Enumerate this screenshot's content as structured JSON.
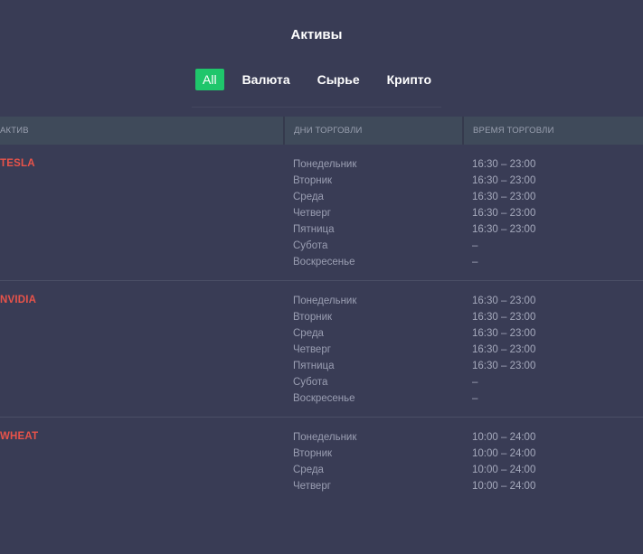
{
  "page": {
    "title": "Активы"
  },
  "tabs": [
    {
      "label": "All",
      "active": true
    },
    {
      "label": "Валюта",
      "active": false
    },
    {
      "label": "Сырье",
      "active": false
    },
    {
      "label": "Крипто",
      "active": false
    }
  ],
  "table": {
    "headers": {
      "asset": "АКТИВ",
      "days": "ДНИ ТОРГОВЛИ",
      "time": "ВРЕМЯ ТОРГОВЛИ"
    },
    "rows": [
      {
        "asset": "TESLA",
        "days": [
          "Понедельник",
          "Вторник",
          "Среда",
          "Четверг",
          "Пятница",
          "Субота",
          "Воскресенье"
        ],
        "times": [
          "16:30 – 23:00",
          "16:30 – 23:00",
          "16:30 – 23:00",
          "16:30 – 23:00",
          "16:30 – 23:00",
          "–",
          "–"
        ]
      },
      {
        "asset": "NVIDIA",
        "days": [
          "Понедельник",
          "Вторник",
          "Среда",
          "Четверг",
          "Пятница",
          "Субота",
          "Воскресенье"
        ],
        "times": [
          "16:30 – 23:00",
          "16:30 – 23:00",
          "16:30 – 23:00",
          "16:30 – 23:00",
          "16:30 – 23:00",
          "–",
          "–"
        ]
      },
      {
        "asset": "WHEAT",
        "days": [
          "Понедельник",
          "Вторник",
          "Среда",
          "Четверг"
        ],
        "times": [
          "10:00 – 24:00",
          "10:00 – 24:00",
          "10:00 – 24:00",
          "10:00 – 24:00"
        ]
      }
    ]
  },
  "colors": {
    "background": "#393c55",
    "header_bg": "#3f4a5a",
    "accent_green": "#1fc66b",
    "asset_red": "#e8534a",
    "muted_text": "#9a9eb2"
  }
}
